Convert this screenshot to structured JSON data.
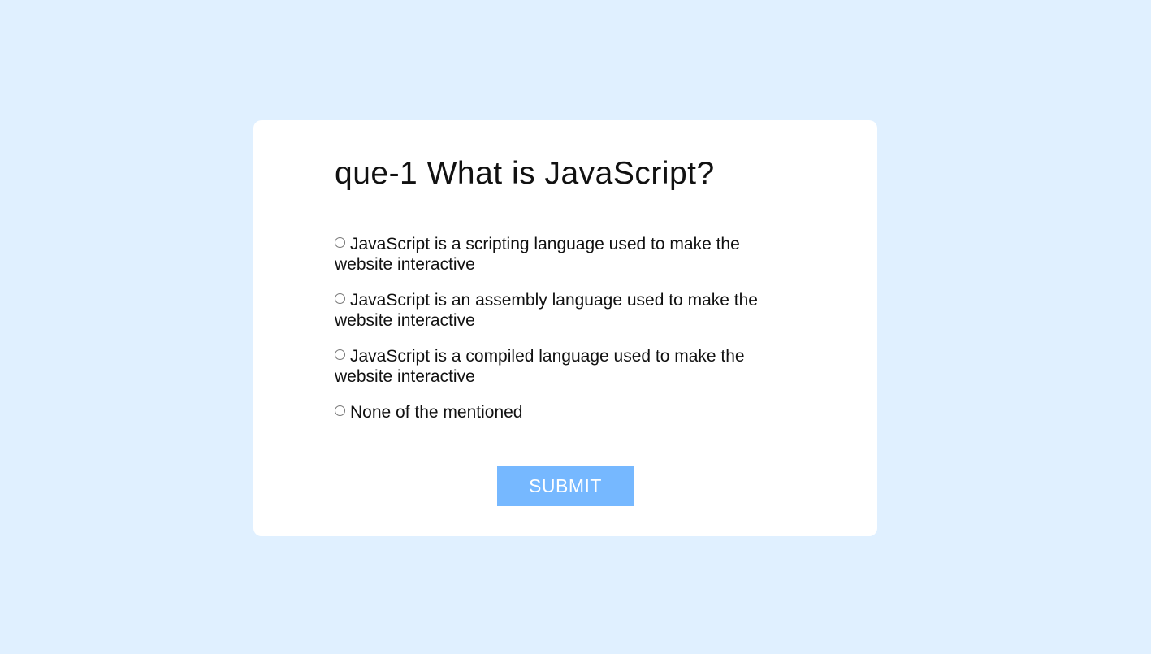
{
  "quiz": {
    "question": "que-1 What is JavaScript?",
    "options": [
      {
        "label": "JavaScript is a scripting language used to make the website interactive"
      },
      {
        "label": "JavaScript is an assembly language used to make the website interactive"
      },
      {
        "label": "JavaScript is a compiled language used to make the website interactive"
      },
      {
        "label": "None of the mentioned"
      }
    ],
    "submit_label": "SUBMIT"
  },
  "colors": {
    "background": "#e0f0ff",
    "card": "#ffffff",
    "button": "#76b8ff"
  }
}
